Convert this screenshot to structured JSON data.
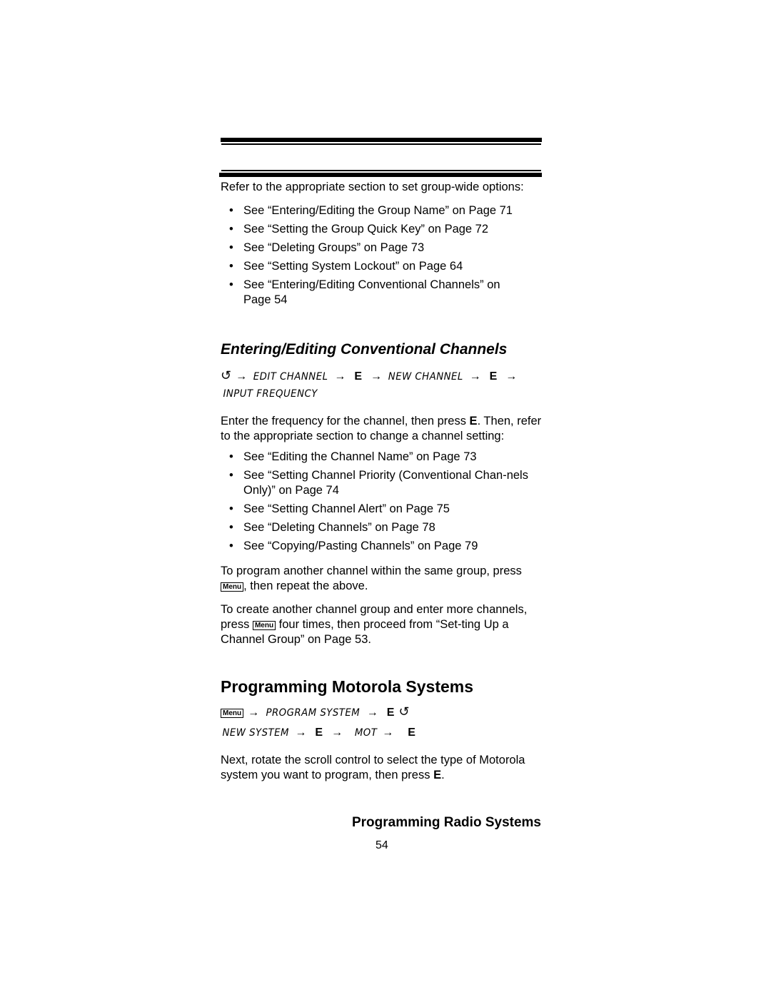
{
  "intro": {
    "text": "Refer to the appropriate section to set group-wide options:",
    "bullets": [
      "See “Entering/Editing the Group Name” on Page 71",
      "See “Setting the Group Quick Key” on Page 72",
      "See “Deleting Groups” on Page 73",
      "See “Setting System Lockout” on Page 64",
      "See “Entering/Editing Conventional Channels” on Page 54"
    ]
  },
  "section1": {
    "heading": "Entering/Editing Conventional Channels",
    "keypath": {
      "rotate_icon": "↺",
      "arrow": "→",
      "step1": "EDIT CHANNEL",
      "key1": "E",
      "step2": "NEW CHANNEL",
      "key2": "E",
      "step3": "INPUT FREQUENCY"
    },
    "body_parts": [
      "Enter the frequency for the channel, then press ",
      "E",
      ". Then, refer to the appropriate section to change a channel setting:"
    ],
    "bullets": [
      "See “Editing the Channel Name” on Page 73",
      "See “Setting Channel Priority (Conventional Chan-nels Only)” on Page 74",
      "See “Setting Channel Alert” on Page 75",
      "See “Deleting Channels” on Page 78",
      "See “Copying/Pasting Channels” on Page 79"
    ],
    "para2_before": "To program another channel within the same group, press",
    "para2_after": ", then repeat the above.",
    "para3_before": "To create another channel group and enter more channels, press",
    "para3_after": " four times, then proceed from “Set-ting Up a Channel Group” on Page 53.",
    "menu_key": "Menu"
  },
  "section2": {
    "heading": "Programming Motorola Systems",
    "keypath": {
      "menu_key": "Menu",
      "arrow": "→",
      "step1": "PROGRAM SYSTEM",
      "key1": "E",
      "rotate_icon": "↺",
      "step2": "NEW SYSTEM",
      "key2": "E",
      "step3": "MOT",
      "key3": "E"
    },
    "body_parts": [
      "Next, rotate the scroll control to select the type of Motorola system you want to program, then press ",
      "E",
      "."
    ]
  },
  "footer": {
    "title": "Programming Radio Systems",
    "page_number": "54"
  }
}
